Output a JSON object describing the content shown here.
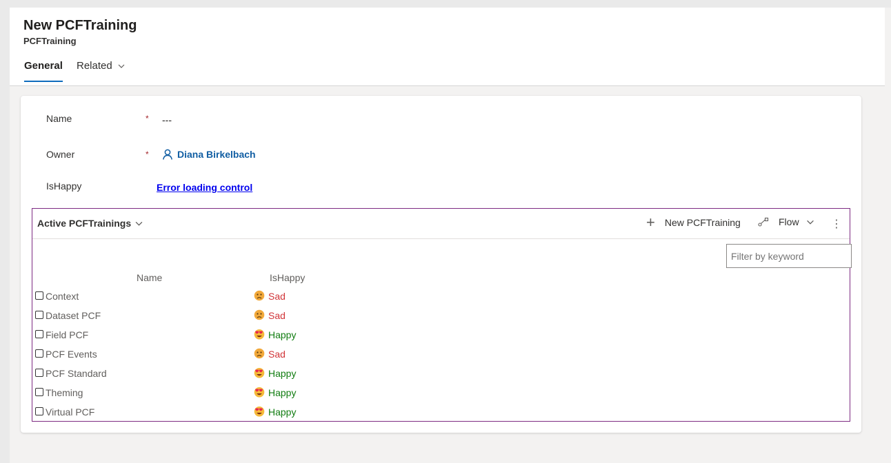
{
  "record": {
    "title": "New PCFTraining",
    "entity": "PCFTraining"
  },
  "tabs": [
    {
      "label": "General"
    },
    {
      "label": "Related"
    }
  ],
  "form": {
    "name_label": "Name",
    "name_value": "---",
    "owner_label": "Owner",
    "owner_value": "Diana Birkelbach",
    "ishappy_label": "IsHappy",
    "ishappy_error": "Error loading control",
    "required_mark": "*"
  },
  "subgrid": {
    "view_name": "Active PCFTrainings",
    "new_button": "New PCFTraining",
    "flow_button": "Flow",
    "more_label": "⋮",
    "filter_placeholder": "Filter by keyword",
    "columns": [
      "Name",
      "IsHappy"
    ],
    "rows": [
      {
        "name": "Context",
        "state": "Sad",
        "kind": "sad"
      },
      {
        "name": "Dataset PCF",
        "state": "Sad",
        "kind": "sad"
      },
      {
        "name": "Field PCF",
        "state": "Happy",
        "kind": "happy"
      },
      {
        "name": "PCF Events",
        "state": "Sad",
        "kind": "sad"
      },
      {
        "name": "PCF Standard",
        "state": "Happy",
        "kind": "happy"
      },
      {
        "name": "Theming",
        "state": "Happy",
        "kind": "happy"
      },
      {
        "name": "Virtual PCF",
        "state": "Happy",
        "kind": "happy"
      }
    ]
  },
  "icons": {
    "owner": "person-icon",
    "sad": "sad-face-icon",
    "happy": "heart-eyes-icon",
    "flow": "flow-icon"
  },
  "colors": {
    "accent": "#0f6cbd",
    "subgrid_border": "#7d2982",
    "sad": "#d13438",
    "happy": "#107c10"
  }
}
